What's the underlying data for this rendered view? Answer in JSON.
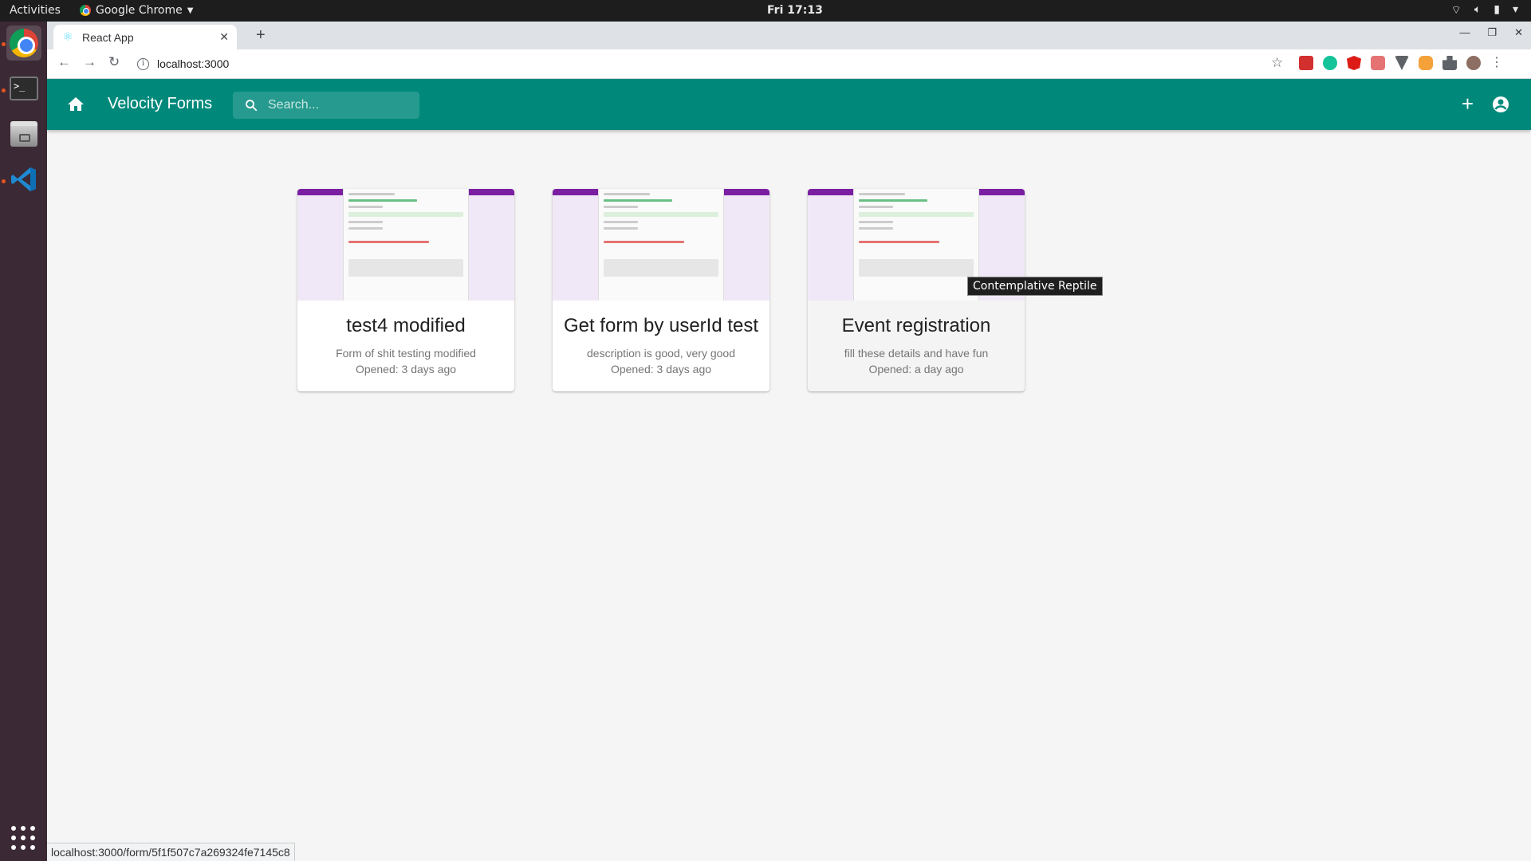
{
  "system": {
    "activities": "Activities",
    "app_menu": "Google Chrome",
    "clock": "Fri 17:13"
  },
  "browser": {
    "tab_title": "React App",
    "url": "localhost:3000",
    "status_url": "localhost:3000/form/5f1f507c7a269324fe7145c8"
  },
  "app": {
    "brand": "Velocity Forms",
    "search_placeholder": "Search...",
    "accent": "#00897b"
  },
  "cards": [
    {
      "title": "test4 modified",
      "description": "Form of shit testing modified",
      "opened": "Opened: 3 days ago"
    },
    {
      "title": "Get form by userId test",
      "description": "description is good, very good",
      "opened": "Opened: 3 days ago"
    },
    {
      "title": "Event registration",
      "description": "fill these details and have fun",
      "opened": "Opened: a day ago"
    }
  ],
  "tooltip": "Contemplative Reptile"
}
